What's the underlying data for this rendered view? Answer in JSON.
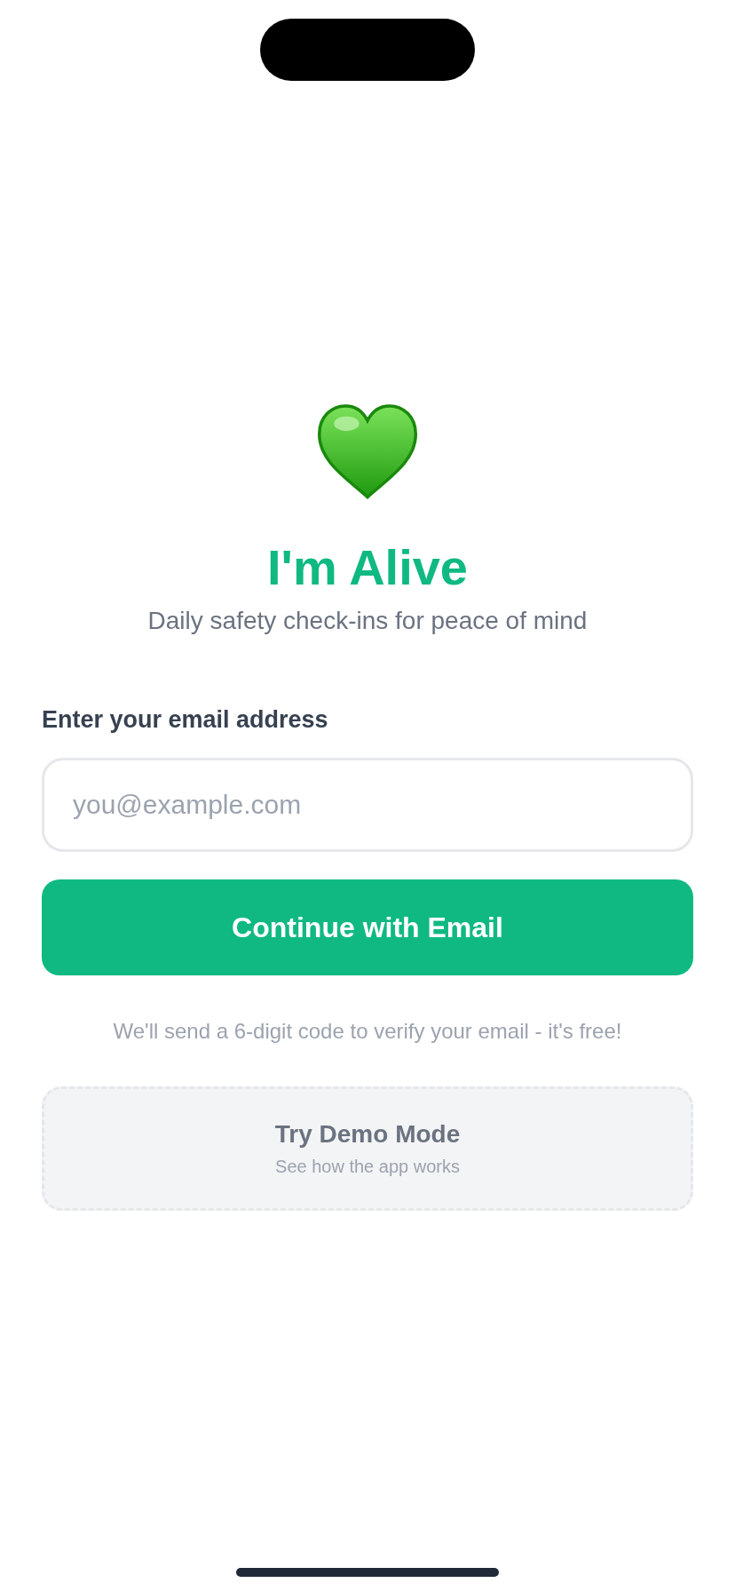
{
  "app": {
    "title": "I'm Alive",
    "subtitle": "Daily safety check-ins for peace of mind"
  },
  "email_form": {
    "label": "Enter your email address",
    "placeholder": "you@example.com",
    "button": "Continue with Email",
    "note": "We'll send a 6-digit code to verify your email - it's free!"
  },
  "demo": {
    "title": "Try Demo Mode",
    "subtitle": "See how the app works"
  }
}
